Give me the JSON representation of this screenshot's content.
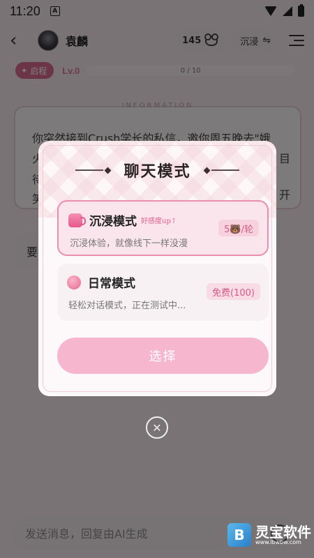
{
  "status_bar": {
    "time": "11:20",
    "notification_icon": "A"
  },
  "top_bar": {
    "character_name": "袁麟",
    "coin_count": "145",
    "mode_label": "沉浸",
    "mode_swap_glyph": "⇋"
  },
  "level_bar": {
    "stage_label": "启程",
    "level_label": "Lv.0",
    "progress_text": "0 / 10",
    "progress_fraction": 0
  },
  "info_card": {
    "header": "INFORMATION",
    "line1": "你突然接到Crush学长的私信，邀你周五晚去\"娥",
    "line2_start": "火",
    "line2_end": "目",
    "line3_start": "待",
    "line4_start": "笑",
    "line4_end": "开"
  },
  "request_bubble": {
    "text": "要"
  },
  "input": {
    "placeholder": "发送消息，回复由AI生成"
  },
  "modal": {
    "title": "聊天模式",
    "options": [
      {
        "title": "沉浸模式",
        "tag": "好感度up↑",
        "price": "5🐻/轮",
        "description": "沉浸体验，就像线下一样没漫",
        "icon": "cup-icon",
        "selected": true
      },
      {
        "title": "日常模式",
        "tag": "",
        "price": "免费(100)",
        "description": "轻松对话模式，正在测试中...",
        "icon": "gift-icon",
        "selected": false
      }
    ],
    "select_label": "选择"
  },
  "close_glyph": "✕",
  "watermark": {
    "logo": "B",
    "name": "灵宝软件",
    "site": "www.lbwbw.com"
  },
  "colors": {
    "accent_pink": "#e98eae",
    "button_pink": "#f6b6cd",
    "price_text": "#d45b84",
    "stage_badge": "#d9688f"
  }
}
